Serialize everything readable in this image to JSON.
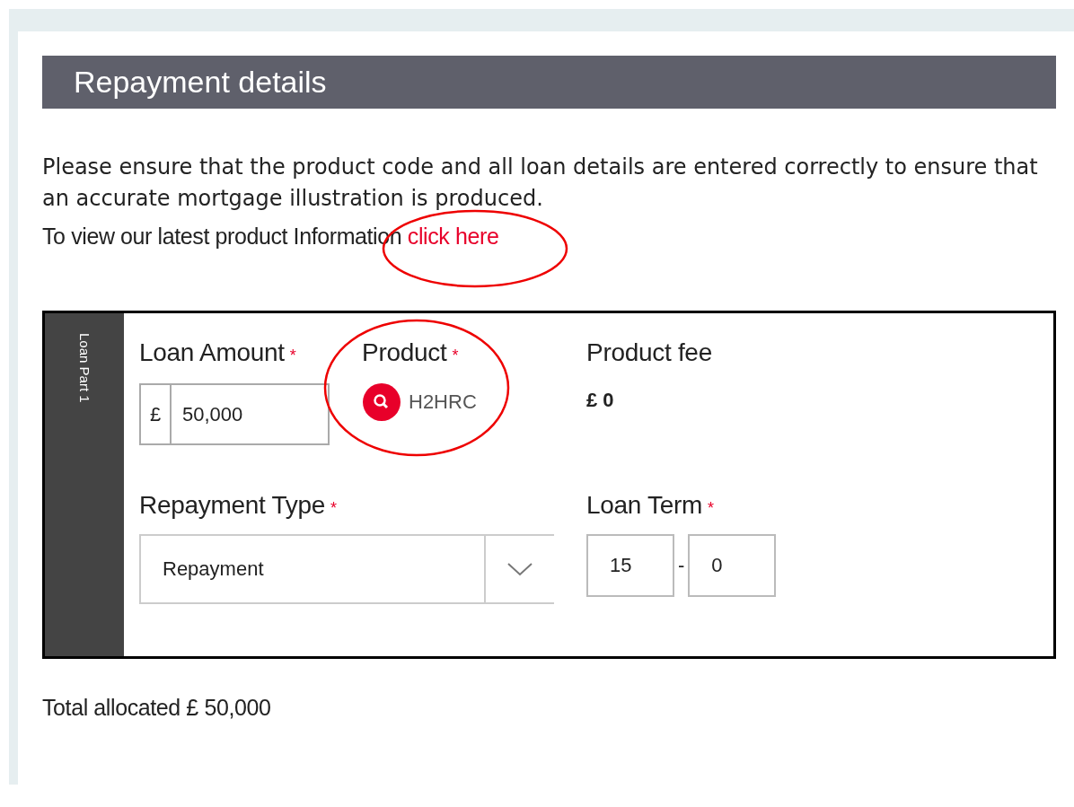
{
  "header": {
    "title": "Repayment details"
  },
  "intro": "Please ensure that the product code and all loan details are entered correctly to ensure that an accurate mortgage illustration is produced.",
  "info_line": {
    "text": "To view our latest product Information",
    "link": "click here"
  },
  "loan_part": {
    "label": "Loan Part 1",
    "loan_amount": {
      "label": "Loan Amount",
      "required_mark": "*",
      "currency": "£",
      "value": "50,000"
    },
    "product": {
      "label": "Product",
      "required_mark": "*",
      "code": "H2HRC"
    },
    "product_fee": {
      "label": "Product fee",
      "value": "£ 0"
    },
    "repayment_type": {
      "label": "Repayment Type",
      "required_mark": "*",
      "value": "Repayment"
    },
    "loan_term": {
      "label": "Loan Term",
      "required_mark": "*",
      "years": "15",
      "separator": "-",
      "months": "0"
    }
  },
  "total": "Total allocated £ 50,000"
}
